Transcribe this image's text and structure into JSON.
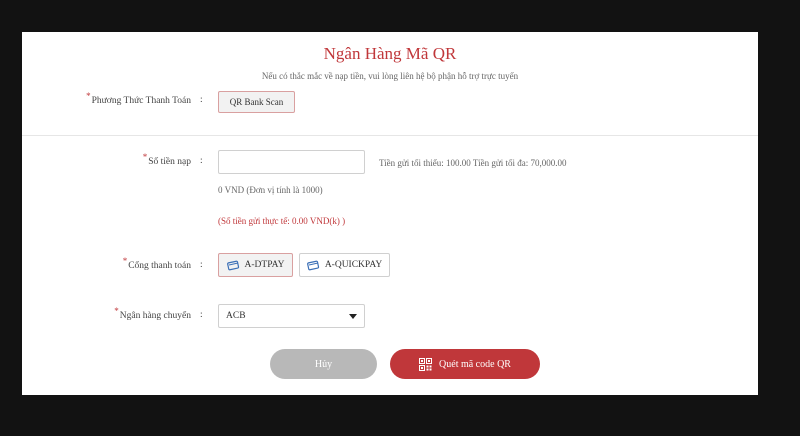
{
  "header": {
    "title": "Ngân Hàng Mã QR",
    "subtitle": "Nếu có thắc mắc về nạp tiền, vui lòng liên hệ bộ phận hỗ trợ trực tuyến"
  },
  "form": {
    "required_mark": "*",
    "colon": ":",
    "method": {
      "label": "Phương Thức Thanh Toán",
      "option": "QR Bank Scan"
    },
    "amount": {
      "label": "Số tiền nạp",
      "value": "",
      "limits": "Tiền gửi tối thiểu: 100.00 Tiền gửi tối đa: 70,000.00",
      "unit_note": "0 VND (Đơn vị tính là 1000)",
      "actual_note": "(Số tiền gửi thực tế: 0.00 VND(k) )"
    },
    "gateway": {
      "label": "Cổng thanh toán",
      "options": [
        {
          "label": "A-DTPAY",
          "selected": true
        },
        {
          "label": "A-QUICKPAY",
          "selected": false
        }
      ]
    },
    "bank": {
      "label": "Ngân hàng chuyển",
      "selected": "ACB"
    }
  },
  "actions": {
    "cancel_label": "Hủy",
    "scan_label": "Quét mã code QR"
  },
  "colors": {
    "accent": "#c0373a",
    "cancel": "#b8b8b8",
    "background": "#121212"
  }
}
